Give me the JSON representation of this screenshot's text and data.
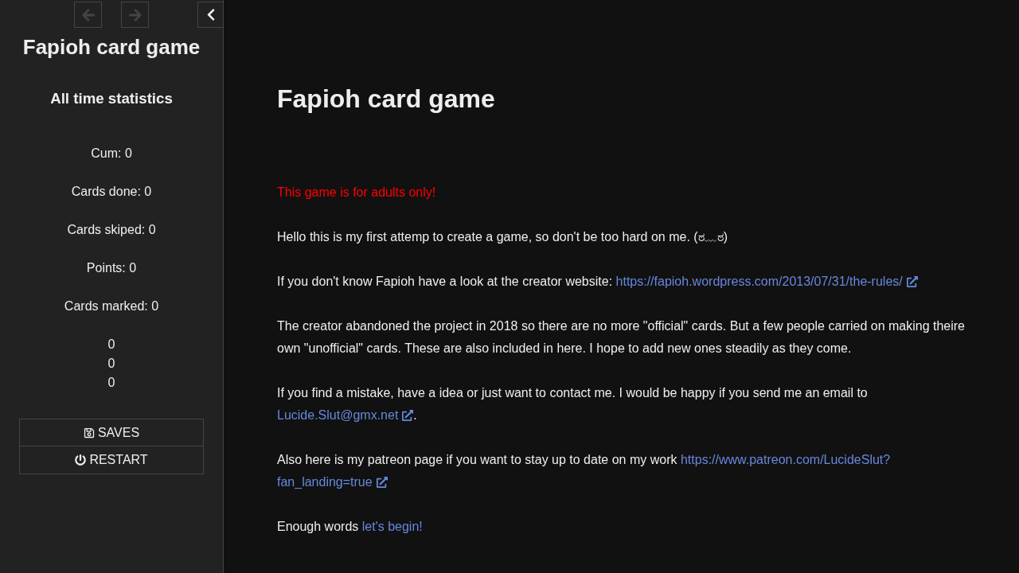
{
  "sidebar": {
    "history_buttons": [
      {
        "kind": "back",
        "disabled": true
      },
      {
        "kind": "forward",
        "disabled": true
      }
    ],
    "story_title": "Fapioh card game",
    "stats_heading": "All time statistics",
    "stats": [
      "Cum: 0",
      "Cards done: 0",
      "Cards skiped: 0",
      "Points: 0",
      "Cards marked: 0"
    ],
    "counters": [
      "0",
      "0",
      "0"
    ],
    "menu": [
      {
        "kind": "saves",
        "label": "SAVES"
      },
      {
        "kind": "restart",
        "label": "RESTART"
      }
    ]
  },
  "passage": {
    "title": "Fapioh card game",
    "paragraphs": [
      [
        {
          "kind": "warning",
          "text": "This game is for adults only!"
        }
      ],
      [
        {
          "kind": "text",
          "text": "Hello this is my first attemp to create a game, so don't be too hard on me. (ಠ﹏ಠ)"
        }
      ],
      [
        {
          "kind": "text",
          "text": "If you don't know Fapioh have a look at the creator website: "
        },
        {
          "kind": "link",
          "text": "https://fapioh.wordpress.com/2013/07/31/the-rules/",
          "external": true
        }
      ],
      [
        {
          "kind": "text",
          "text": "The creator abandoned the project in 2018 so there are no more \"official\" cards. But a few people carried on making theire own \"unofficial\" cards. These are also included in here. I hope to add new ones steadily as they come."
        }
      ],
      [
        {
          "kind": "text",
          "text": "If you find a mistake, have a idea or just want to contact me. I would be happy if you send me an email to "
        },
        {
          "kind": "link",
          "text": "Lucide.Slut@gmx.net",
          "external": true
        },
        {
          "kind": "text",
          "text": "."
        }
      ],
      [
        {
          "kind": "text",
          "text": "Also here is my patreon page if you want to stay up to date on my work "
        },
        {
          "kind": "link",
          "text": "https://www.patreon.com/LucideSlut?",
          "external": false
        },
        {
          "kind": "link",
          "text": "fan_landing=true",
          "external": true
        }
      ],
      [
        {
          "kind": "text",
          "text": "Enough words "
        },
        {
          "kind": "link",
          "text": "let's begin!",
          "external": false
        }
      ]
    ]
  }
}
